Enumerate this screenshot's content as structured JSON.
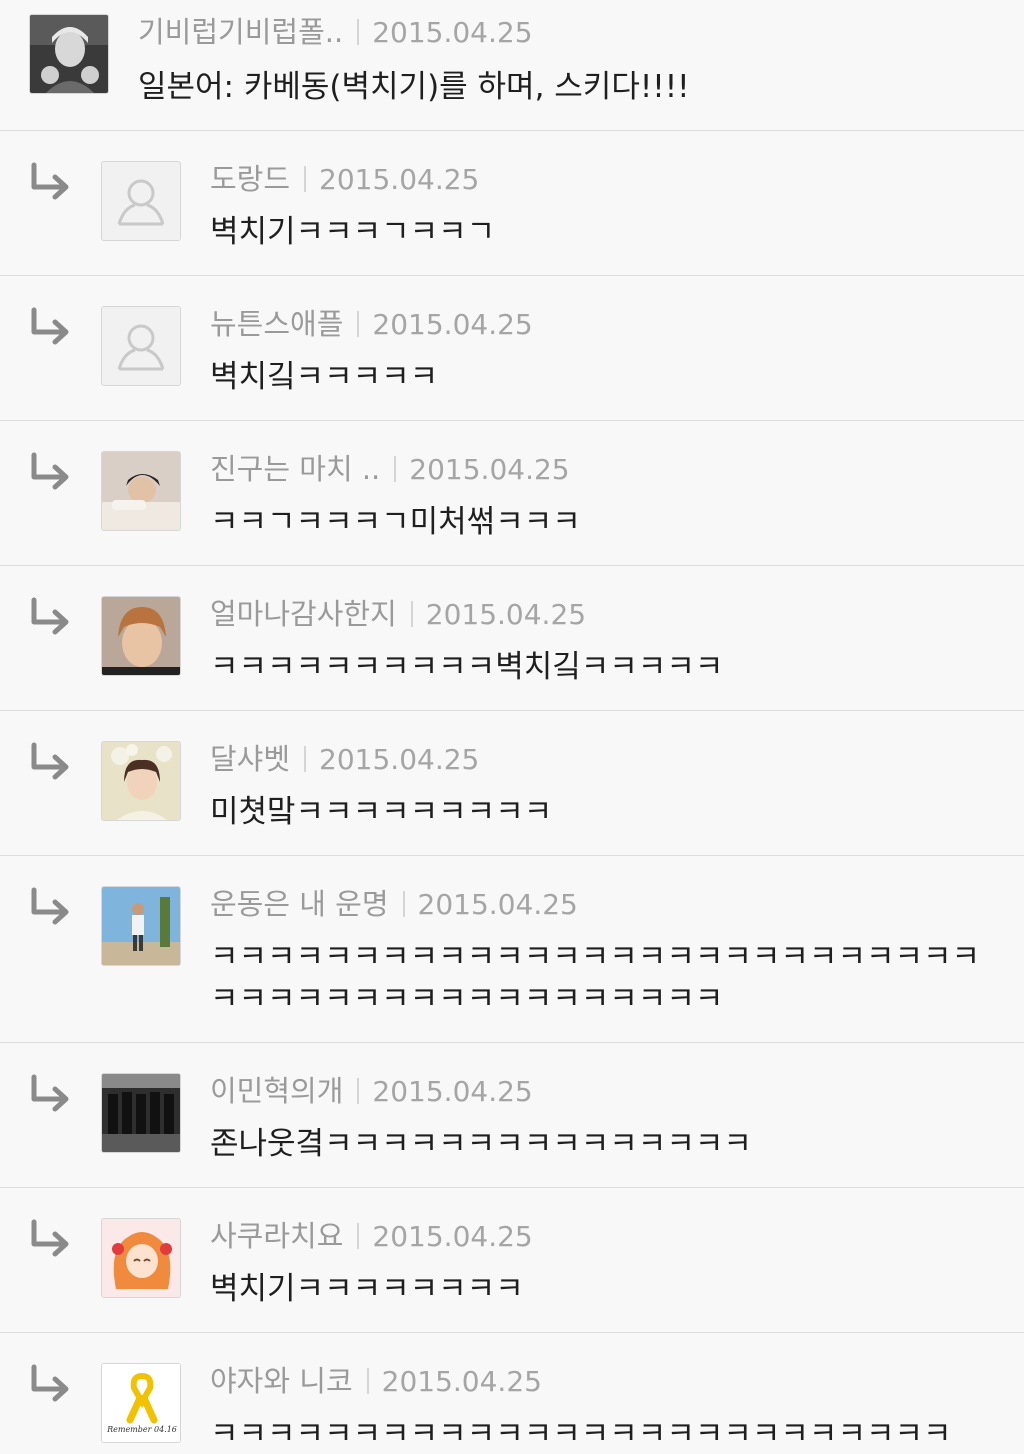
{
  "comments": [
    {
      "user": "기비럽기비럽폴..",
      "date": "2015.04.25",
      "text": "일본어: 카베동(벽치기)를 하며, 스키다!!!!",
      "avatar": "photo-avatar"
    },
    {
      "user": "도랑드",
      "date": "2015.04.25",
      "text": "벽치기ㅋㅋㅋㄱㅋㅋㄱ",
      "avatar": "default-avatar"
    },
    {
      "user": "뉴튼스애플",
      "date": "2015.04.25",
      "text": "벽치깈ㅋㅋㅋㅋㅋ",
      "avatar": "default-avatar"
    },
    {
      "user": "진구는 마치 ..",
      "date": "2015.04.25",
      "text": "ㅋㅋㄱㅋㅋㅋㄱ미처썪ㅋㅋㅋ",
      "avatar": "photo-avatar"
    },
    {
      "user": "얼마나감사한지",
      "date": "2015.04.25",
      "text": "ㅋㅋㅋㅋㅋㅋㅋㅋㅋㅋ벽치깈ㅋㅋㅋㅋㅋ",
      "avatar": "photo-avatar"
    },
    {
      "user": "달샤벳",
      "date": "2015.04.25",
      "text": "미쳣맠ㅋㅋㅋㅋㅋㅋㅋㅋㅋ",
      "avatar": "photo-avatar"
    },
    {
      "user": "운동은 내 운명",
      "date": "2015.04.25",
      "text": "ㅋㅋㅋㅋㅋㅋㅋㅋㅋㅋㅋㅋㅋㅋㅋㅋㅋㅋㅋㅋㅋㅋㅋㅋㅋㅋㅋㅋㅋㅋㅋㅋㅋㅋㅋㅋㅋㅋㅋㅋㅋㅋㅋㅋㅋ",
      "avatar": "photo-avatar"
    },
    {
      "user": "이민혁의개",
      "date": "2015.04.25",
      "text": "존나웃곀ㅋㅋㅋㅋㅋㅋㅋㅋㅋㅋㅋㅋㅋㅋㅋ",
      "avatar": "photo-avatar"
    },
    {
      "user": "사쿠라치요",
      "date": "2015.04.25",
      "text": "벽치기ㅋㅋㅋㅋㅋㅋㅋㅋ",
      "avatar": "photo-avatar"
    },
    {
      "user": "야자와 니코",
      "date": "2015.04.25",
      "text": "ㅋㅋㅋㅋㅋㅋㅋㅋㅋㅋㅋㅋㅋㅋㅋㅋㅋㅋㅋㅋㅋㅋㅋㅋㅋㅋ",
      "avatar": "photo-avatar",
      "avatar_caption": "Remember 04.16"
    }
  ]
}
